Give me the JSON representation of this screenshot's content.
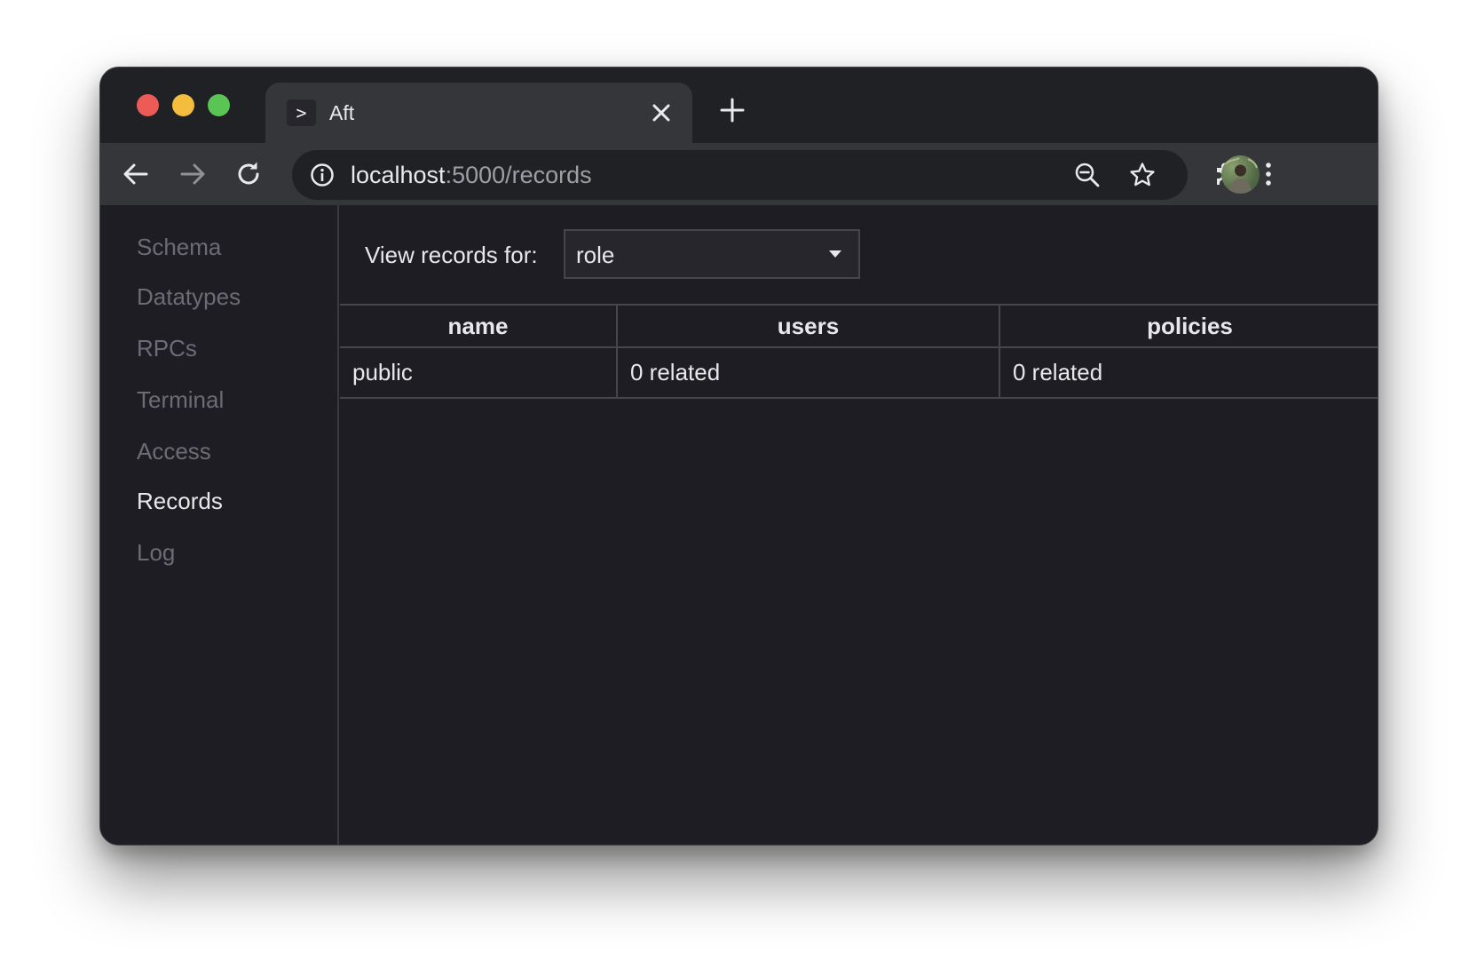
{
  "browser": {
    "tab": {
      "favicon_text": ">",
      "title": "Aft"
    },
    "url": {
      "host": "localhost",
      "path": ":5000/records"
    },
    "icons": {
      "close": "close-icon",
      "new_tab": "plus-icon",
      "back": "back-arrow-icon",
      "forward": "forward-arrow-icon",
      "reload": "reload-icon",
      "info": "info-icon",
      "zoom": "zoom-out-icon",
      "bookmark": "star-icon",
      "extensions": "puzzle-icon",
      "menu": "kebab-menu-icon"
    },
    "colors": {
      "close_light": "#ed5b56",
      "minimize_light": "#f4bd3e",
      "maximize_light": "#5ac554"
    }
  },
  "sidebar": {
    "items": [
      {
        "label": "Schema",
        "active": false
      },
      {
        "label": "Datatypes",
        "active": false
      },
      {
        "label": "RPCs",
        "active": false
      },
      {
        "label": "Terminal",
        "active": false
      },
      {
        "label": "Access",
        "active": false
      },
      {
        "label": "Records",
        "active": true
      },
      {
        "label": "Log",
        "active": false
      }
    ]
  },
  "main": {
    "view_label": "View records for:",
    "selected_type": "role",
    "table": {
      "columns": [
        "name",
        "users",
        "policies"
      ],
      "rows": [
        [
          "public",
          "0 related",
          "0 related"
        ]
      ]
    }
  }
}
